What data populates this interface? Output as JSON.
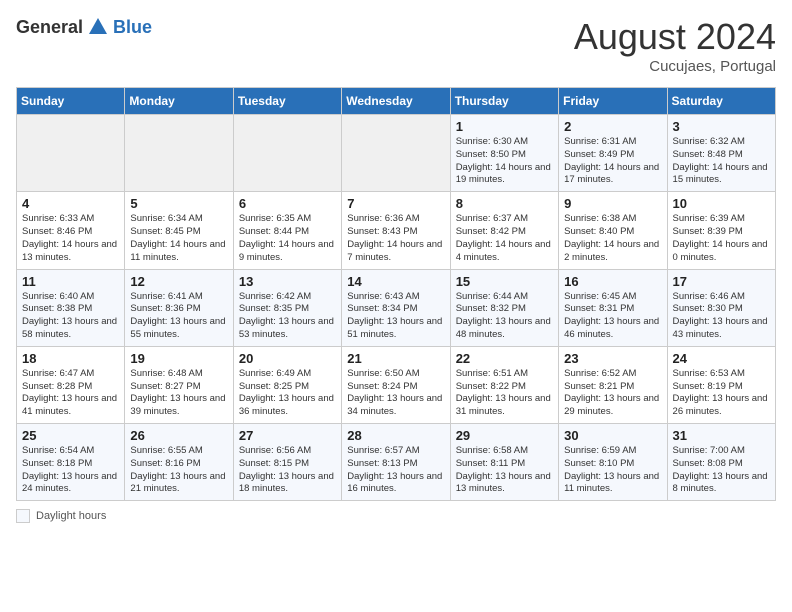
{
  "header": {
    "logo_general": "General",
    "logo_blue": "Blue",
    "month_year": "August 2024",
    "location": "Cucujaes, Portugal"
  },
  "days_of_week": [
    "Sunday",
    "Monday",
    "Tuesday",
    "Wednesday",
    "Thursday",
    "Friday",
    "Saturday"
  ],
  "weeks": [
    [
      {
        "day": "",
        "info": ""
      },
      {
        "day": "",
        "info": ""
      },
      {
        "day": "",
        "info": ""
      },
      {
        "day": "",
        "info": ""
      },
      {
        "day": "1",
        "info": "Sunrise: 6:30 AM\nSunset: 8:50 PM\nDaylight: 14 hours and 19 minutes."
      },
      {
        "day": "2",
        "info": "Sunrise: 6:31 AM\nSunset: 8:49 PM\nDaylight: 14 hours and 17 minutes."
      },
      {
        "day": "3",
        "info": "Sunrise: 6:32 AM\nSunset: 8:48 PM\nDaylight: 14 hours and 15 minutes."
      }
    ],
    [
      {
        "day": "4",
        "info": "Sunrise: 6:33 AM\nSunset: 8:46 PM\nDaylight: 14 hours and 13 minutes."
      },
      {
        "day": "5",
        "info": "Sunrise: 6:34 AM\nSunset: 8:45 PM\nDaylight: 14 hours and 11 minutes."
      },
      {
        "day": "6",
        "info": "Sunrise: 6:35 AM\nSunset: 8:44 PM\nDaylight: 14 hours and 9 minutes."
      },
      {
        "day": "7",
        "info": "Sunrise: 6:36 AM\nSunset: 8:43 PM\nDaylight: 14 hours and 7 minutes."
      },
      {
        "day": "8",
        "info": "Sunrise: 6:37 AM\nSunset: 8:42 PM\nDaylight: 14 hours and 4 minutes."
      },
      {
        "day": "9",
        "info": "Sunrise: 6:38 AM\nSunset: 8:40 PM\nDaylight: 14 hours and 2 minutes."
      },
      {
        "day": "10",
        "info": "Sunrise: 6:39 AM\nSunset: 8:39 PM\nDaylight: 14 hours and 0 minutes."
      }
    ],
    [
      {
        "day": "11",
        "info": "Sunrise: 6:40 AM\nSunset: 8:38 PM\nDaylight: 13 hours and 58 minutes."
      },
      {
        "day": "12",
        "info": "Sunrise: 6:41 AM\nSunset: 8:36 PM\nDaylight: 13 hours and 55 minutes."
      },
      {
        "day": "13",
        "info": "Sunrise: 6:42 AM\nSunset: 8:35 PM\nDaylight: 13 hours and 53 minutes."
      },
      {
        "day": "14",
        "info": "Sunrise: 6:43 AM\nSunset: 8:34 PM\nDaylight: 13 hours and 51 minutes."
      },
      {
        "day": "15",
        "info": "Sunrise: 6:44 AM\nSunset: 8:32 PM\nDaylight: 13 hours and 48 minutes."
      },
      {
        "day": "16",
        "info": "Sunrise: 6:45 AM\nSunset: 8:31 PM\nDaylight: 13 hours and 46 minutes."
      },
      {
        "day": "17",
        "info": "Sunrise: 6:46 AM\nSunset: 8:30 PM\nDaylight: 13 hours and 43 minutes."
      }
    ],
    [
      {
        "day": "18",
        "info": "Sunrise: 6:47 AM\nSunset: 8:28 PM\nDaylight: 13 hours and 41 minutes."
      },
      {
        "day": "19",
        "info": "Sunrise: 6:48 AM\nSunset: 8:27 PM\nDaylight: 13 hours and 39 minutes."
      },
      {
        "day": "20",
        "info": "Sunrise: 6:49 AM\nSunset: 8:25 PM\nDaylight: 13 hours and 36 minutes."
      },
      {
        "day": "21",
        "info": "Sunrise: 6:50 AM\nSunset: 8:24 PM\nDaylight: 13 hours and 34 minutes."
      },
      {
        "day": "22",
        "info": "Sunrise: 6:51 AM\nSunset: 8:22 PM\nDaylight: 13 hours and 31 minutes."
      },
      {
        "day": "23",
        "info": "Sunrise: 6:52 AM\nSunset: 8:21 PM\nDaylight: 13 hours and 29 minutes."
      },
      {
        "day": "24",
        "info": "Sunrise: 6:53 AM\nSunset: 8:19 PM\nDaylight: 13 hours and 26 minutes."
      }
    ],
    [
      {
        "day": "25",
        "info": "Sunrise: 6:54 AM\nSunset: 8:18 PM\nDaylight: 13 hours and 24 minutes."
      },
      {
        "day": "26",
        "info": "Sunrise: 6:55 AM\nSunset: 8:16 PM\nDaylight: 13 hours and 21 minutes."
      },
      {
        "day": "27",
        "info": "Sunrise: 6:56 AM\nSunset: 8:15 PM\nDaylight: 13 hours and 18 minutes."
      },
      {
        "day": "28",
        "info": "Sunrise: 6:57 AM\nSunset: 8:13 PM\nDaylight: 13 hours and 16 minutes."
      },
      {
        "day": "29",
        "info": "Sunrise: 6:58 AM\nSunset: 8:11 PM\nDaylight: 13 hours and 13 minutes."
      },
      {
        "day": "30",
        "info": "Sunrise: 6:59 AM\nSunset: 8:10 PM\nDaylight: 13 hours and 11 minutes."
      },
      {
        "day": "31",
        "info": "Sunrise: 7:00 AM\nSunset: 8:08 PM\nDaylight: 13 hours and 8 minutes."
      }
    ]
  ],
  "legend": {
    "label": "Daylight hours"
  }
}
